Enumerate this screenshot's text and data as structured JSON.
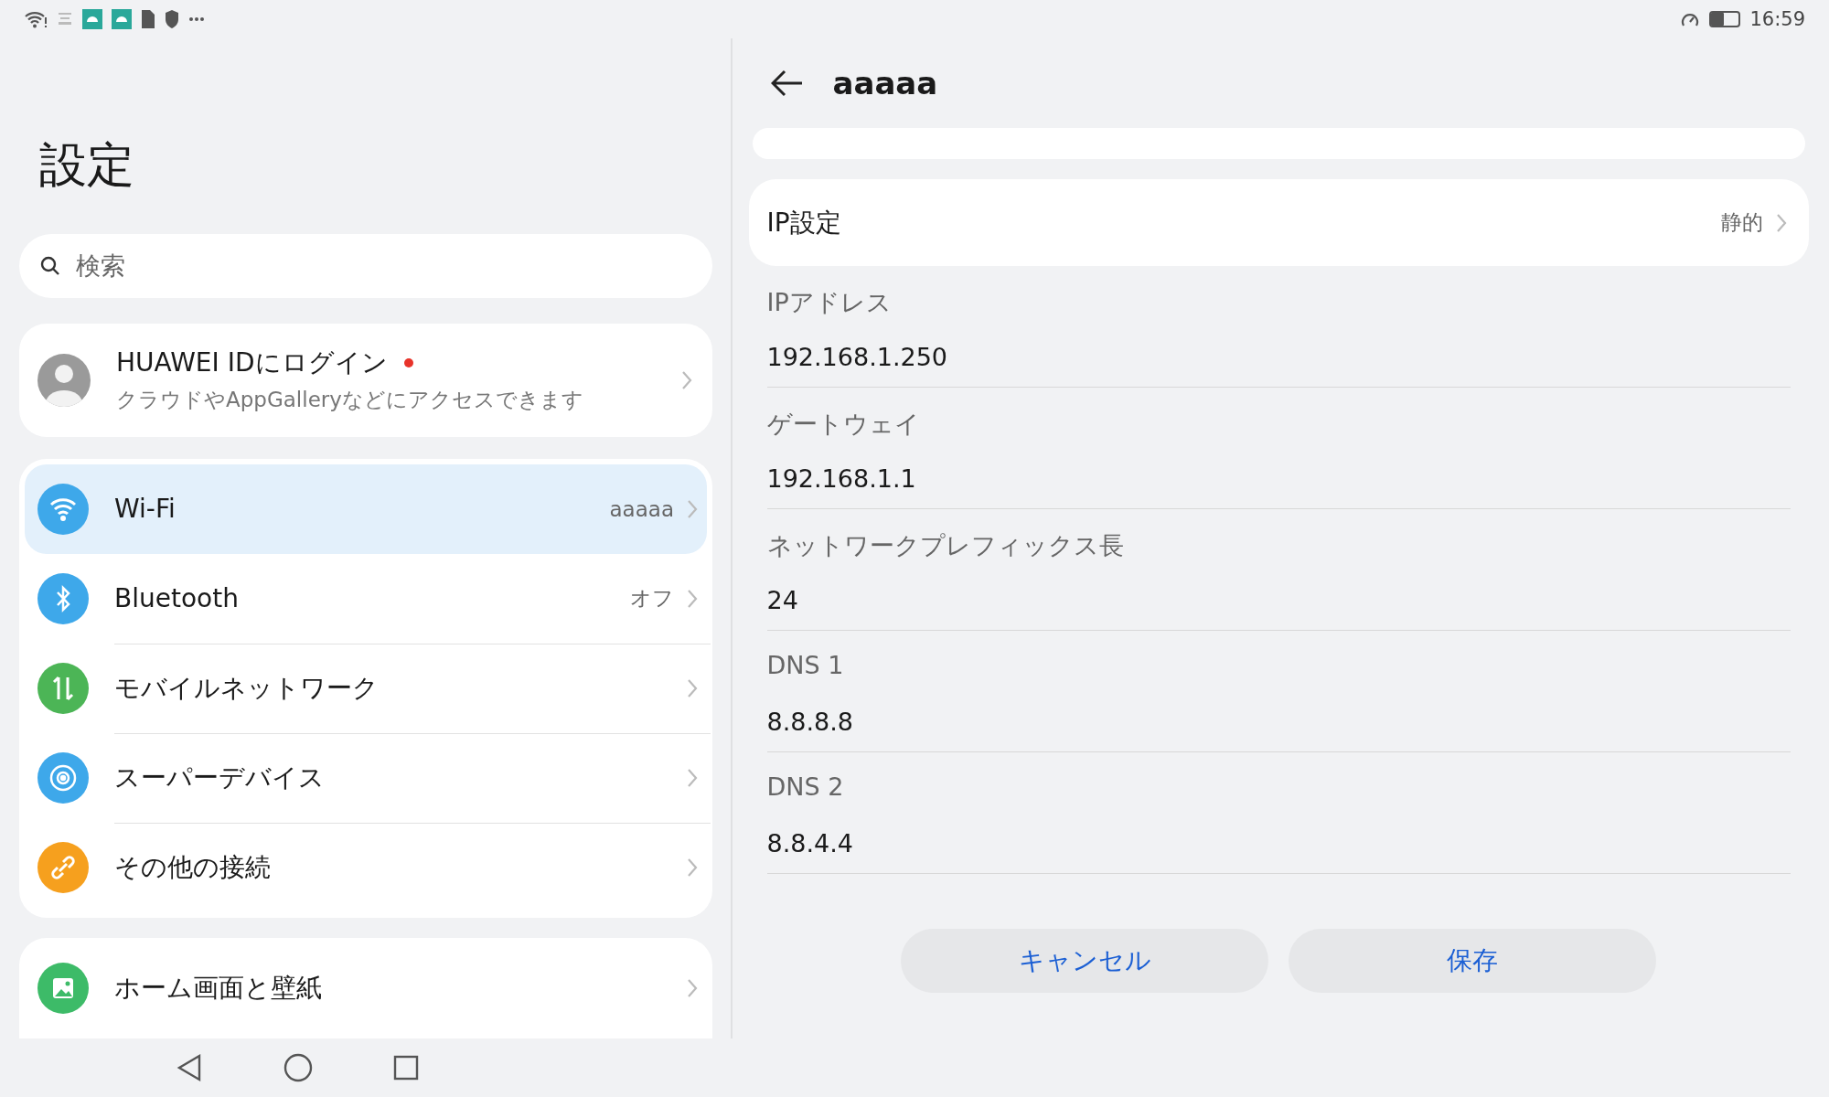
{
  "status_bar": {
    "time": "16:59",
    "battery": {
      "level": 0.45
    }
  },
  "sidebar": {
    "title": "設定",
    "search": {
      "placeholder": "検索"
    },
    "account": {
      "title": "HUAWEI IDにログイン",
      "subtitle": "クラウドやAppGalleryなどにアクセスできます",
      "notification": true
    },
    "groups": [
      {
        "items": [
          {
            "kind": "wifi",
            "label": "Wi-Fi",
            "value": "aaaaa",
            "color": "#3ea8ea",
            "selected": true
          },
          {
            "kind": "bluetooth",
            "label": "Bluetooth",
            "value": "オフ",
            "color": "#3ea8ea",
            "selected": false
          },
          {
            "kind": "mobile",
            "label": "モバイルネットワーク",
            "color": "#4cb556",
            "selected": false
          },
          {
            "kind": "device",
            "label": "スーパーデバイス",
            "color": "#3ea8ea",
            "selected": false
          },
          {
            "kind": "link",
            "label": "その他の接続",
            "color": "#f6a01e",
            "selected": false
          }
        ]
      },
      {
        "items": [
          {
            "kind": "wallpaper",
            "label": "ホーム画面と壁紙",
            "color": "#3dbb68",
            "selected": false
          }
        ]
      }
    ]
  },
  "detail": {
    "title": "aaaaa",
    "ip_setting": {
      "label": "IP設定",
      "value": "静的"
    },
    "fields": [
      {
        "label": "IPアドレス",
        "value": "192.168.1.250"
      },
      {
        "label": "ゲートウェイ",
        "value": "192.168.1.1"
      },
      {
        "label": "ネットワークプレフィックス長",
        "value": "24"
      },
      {
        "label": "DNS 1",
        "value": "8.8.8.8"
      },
      {
        "label": "DNS 2",
        "value": "8.8.4.4"
      }
    ],
    "buttons": [
      "キャンセル",
      "保存"
    ]
  }
}
